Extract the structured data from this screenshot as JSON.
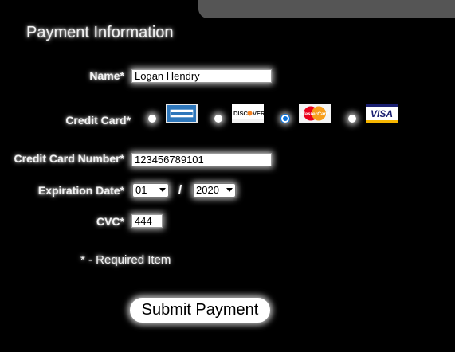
{
  "form": {
    "title": "Payment Information",
    "name_label": "Name*",
    "name_value": "Logan Hendry",
    "card_label": "Credit Card*",
    "card_number_label": "Credit Card Number*",
    "card_number_value": "123456789101",
    "expiration_label": "Expiration Date*",
    "exp_month": "01",
    "exp_separator": "/",
    "exp_year": "2020",
    "cvc_label": "CVC*",
    "cvc_value": "444",
    "required_note": "* - Required Item",
    "submit_label": "Submit Payment"
  },
  "cards": [
    {
      "name": "amex-logo",
      "text": "AMERICAN EXPRESS",
      "selected": false
    },
    {
      "name": "discover-logo",
      "text": "DISCOVER",
      "selected": false
    },
    {
      "name": "mastercard-logo",
      "text": "MasterCard",
      "selected": true
    },
    {
      "name": "visa-logo",
      "text": "VISA",
      "selected": false
    }
  ],
  "colors": {
    "background": "#000000",
    "radio_selected": "#0b74de",
    "amex_blue": "#2e77bb",
    "mastercard_red": "#eb001b",
    "mastercard_orange": "#f79e1b",
    "visa_blue": "#1a1f71",
    "visa_gold": "#f7b600"
  }
}
